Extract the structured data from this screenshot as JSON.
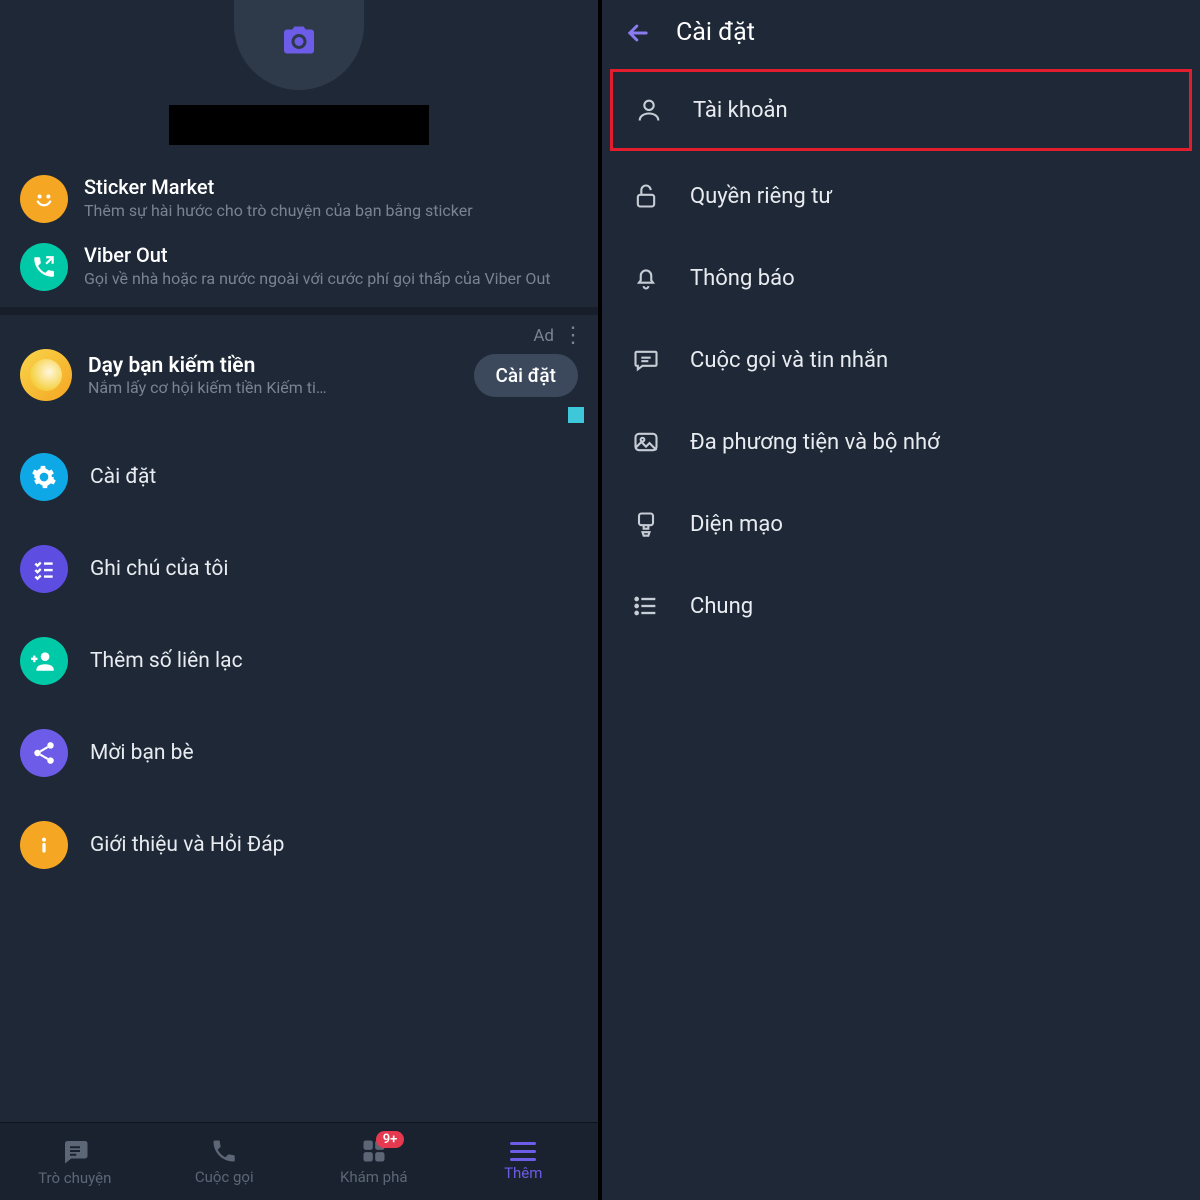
{
  "left": {
    "features": [
      {
        "title": "Sticker Market",
        "subtitle": "Thêm sự hài hước cho trò chuyện của bạn bằng sticker"
      },
      {
        "title": "Viber Out",
        "subtitle": "Gọi về nhà hoặc ra nước ngoài với cước phí gọi thấp của Viber Out"
      }
    ],
    "ad": {
      "marker": "Ad",
      "title": "Dạy bạn kiếm tiền",
      "subtitle": "Nắm lấy cơ hội kiếm tiền Kiếm ti…",
      "button": "Cài đặt"
    },
    "menu": [
      {
        "label": "Cài đặt"
      },
      {
        "label": "Ghi chú của tôi"
      },
      {
        "label": "Thêm số liên lạc"
      },
      {
        "label": "Mời bạn bè"
      },
      {
        "label": "Giới thiệu và Hỏi Đáp"
      }
    ],
    "nav": [
      {
        "label": "Trò chuyện"
      },
      {
        "label": "Cuộc gọi"
      },
      {
        "label": "Khám phá",
        "badge": "9+"
      },
      {
        "label": "Thêm"
      }
    ]
  },
  "right": {
    "header": "Cài đặt",
    "items": [
      {
        "label": "Tài khoản",
        "highlight": true
      },
      {
        "label": "Quyền riêng tư"
      },
      {
        "label": "Thông báo"
      },
      {
        "label": "Cuộc gọi và tin nhắn"
      },
      {
        "label": "Đa phương tiện và bộ nhớ"
      },
      {
        "label": "Diện mạo"
      },
      {
        "label": "Chung"
      }
    ]
  }
}
